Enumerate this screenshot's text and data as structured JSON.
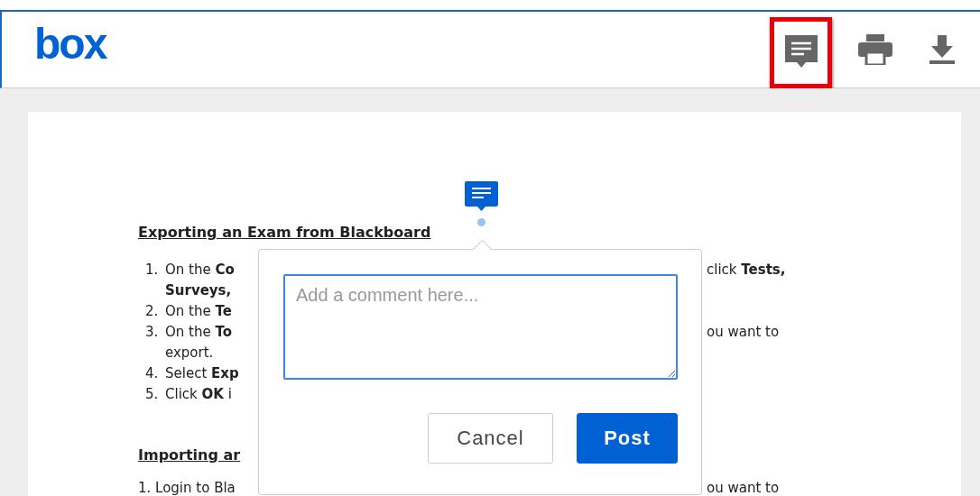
{
  "header": {
    "logo": "box",
    "buttons": [
      {
        "kind": "comment",
        "highlighted": true
      },
      {
        "kind": "print",
        "highlighted": false
      },
      {
        "kind": "download",
        "highlighted": false
      }
    ]
  },
  "document": {
    "sections": [
      {
        "heading": "Exporting an Exam from Blackboard",
        "items": [
          {
            "number": "1.",
            "text": "On the **Co**",
            "right": "click **Tests,**"
          },
          {
            "text": "**Surveys,**"
          },
          {
            "number": "2.",
            "text": "On the **Te**"
          },
          {
            "number": "3.",
            "text": "On the **To**",
            "right": "ou want to"
          },
          {
            "text": "export."
          },
          {
            "number": "4.",
            "text": "Select **Exp**"
          },
          {
            "number": "5.",
            "text": "Click **OK** i"
          }
        ]
      },
      {
        "heading": "Importing ar",
        "items": [
          {
            "text": "1. Login to Bla",
            "right": "ou want to"
          }
        ]
      }
    ]
  },
  "comment_popup": {
    "placeholder": "Add a comment here...",
    "buttons": [
      {
        "label": "Cancel",
        "kind": "secondary"
      },
      {
        "label": "Post",
        "kind": "primary"
      }
    ]
  }
}
